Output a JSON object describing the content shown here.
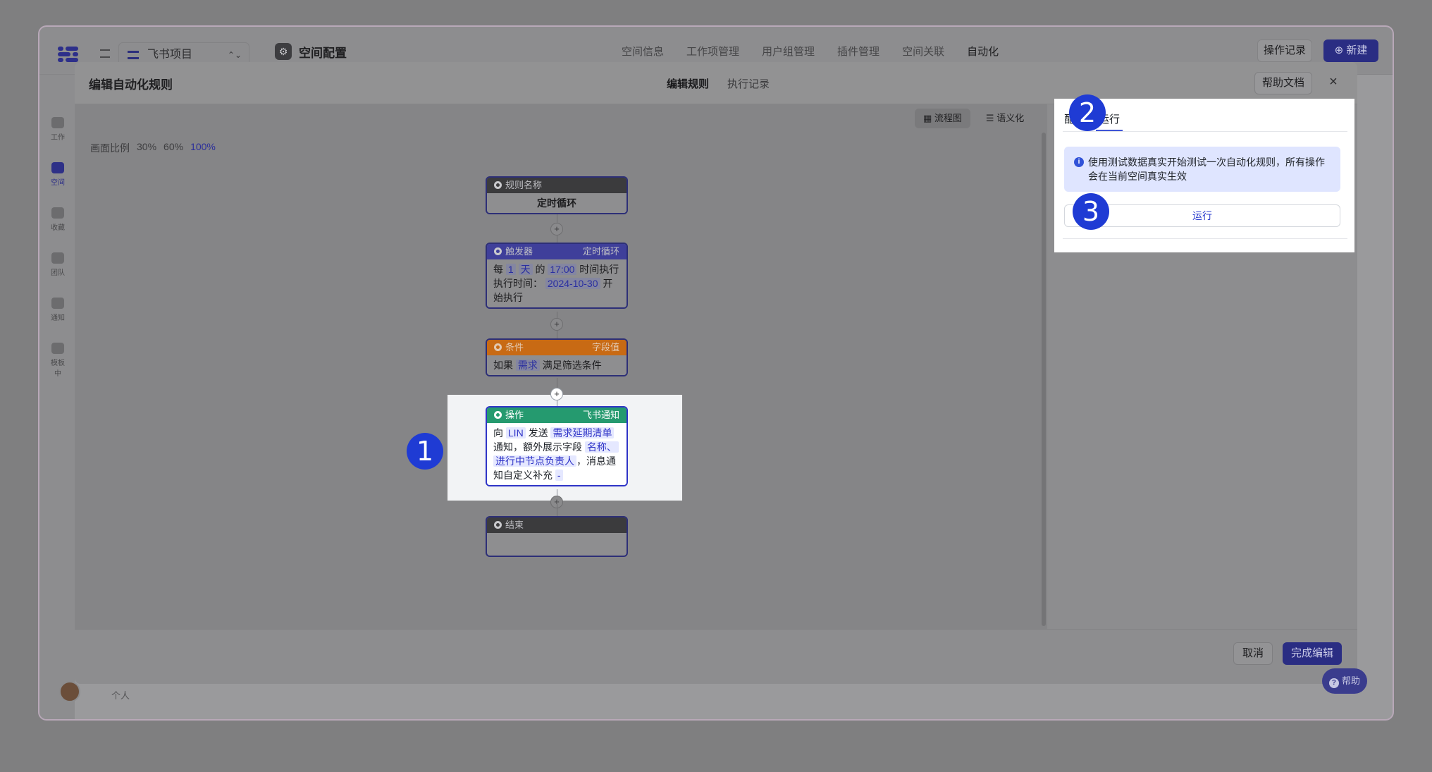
{
  "app": {
    "project_name": "飞书项目",
    "space_title": "空间配置",
    "nav": [
      "空间信息",
      "工作项管理",
      "用户组管理",
      "插件管理",
      "空间关联",
      "自动化"
    ],
    "nav_active": "自动化",
    "op_log_label": "操作记录",
    "new_label": "新建",
    "rail": [
      "工作",
      "空间",
      "收藏",
      "团队",
      "通知",
      "模板中"
    ],
    "bottom_label": "个人"
  },
  "modal": {
    "title": "编辑自动化规则",
    "tabs": [
      "编辑规则",
      "执行记录"
    ],
    "help_doc": "帮助文档",
    "close": "×",
    "view_flow": "流程图",
    "view_semantic": "语义化",
    "scale_label": "画面比例",
    "scales": [
      "30%",
      "60%",
      "100%"
    ],
    "cancel": "取消",
    "done": "完成编辑"
  },
  "flow": {
    "rule": {
      "header": "规则名称",
      "body": "定时循环"
    },
    "trigger": {
      "header": "触发器",
      "tag": "定时循环",
      "p1": "每",
      "v1": "1",
      "v2": "天",
      "p2": "的",
      "v3": "17:00",
      "p3": "时间执行",
      "p4": "执行时间：",
      "v4": "2024-10-30",
      "p5": "开始执行"
    },
    "condition": {
      "header": "条件",
      "tag": "字段值",
      "p1": "如果",
      "v1": "需求",
      "p2": "满足筛选条件"
    },
    "action": {
      "header": "操作",
      "tag": "飞书通知",
      "p1": "向",
      "v1": "LIN",
      "p2": "发送",
      "v2": "需求延期清单",
      "p3": "通知，额外展示字段",
      "v3": "名称、",
      "v4": "进行中节点负责人",
      "p4": "，消息通知自定义补充",
      "v5": "-"
    },
    "end": {
      "header": "结束"
    }
  },
  "run_panel": {
    "tab_partial": "配",
    "tab_run": "运行",
    "info": "使用测试数据真实开始测试一次自动化规则，所有操作会在当前空间真实生效",
    "run_button": "运行"
  },
  "badges": [
    "1",
    "2",
    "3"
  ],
  "help_fab": "帮助",
  "colors": {
    "accent": "#2f34c7",
    "action_header": "#259a6f",
    "condition_header": "#c86a14",
    "trigger_header": "#3f3f9a",
    "badge": "#1f3bd4"
  }
}
